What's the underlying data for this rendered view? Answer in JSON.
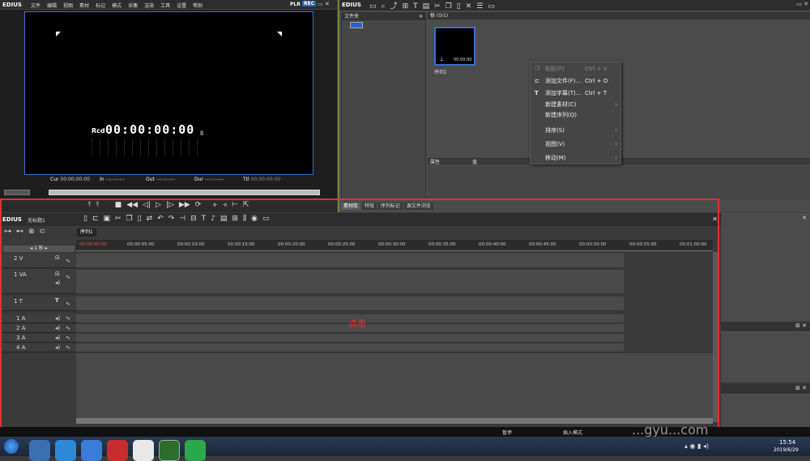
{
  "player": {
    "brand": "EDIUS",
    "menus": [
      "文件",
      "编辑",
      "视图",
      "素材",
      "标记",
      "模式",
      "采集",
      "渲染",
      "工具",
      "设置",
      "帮助"
    ],
    "plr": "PLR",
    "rec": "REC",
    "rcd": "Rcd",
    "timecode": "00:00:00:00",
    "cur_label": "Cur",
    "cur_val": "00:00:00:00",
    "in_label": "In",
    "in_val": "--:--:--:--",
    "out_label": "Out",
    "out_val": "--:--:--:--",
    "ttl_label": "Ttl",
    "ttl_val": "00:00:00:00"
  },
  "bin": {
    "brand": "EDIUS",
    "folder_header": "文件夹",
    "root_label": "根 (0/1)",
    "clip_label": "序列1",
    "clip_overlay": "00:00:00",
    "props_col1": "属性",
    "props_col2": "值",
    "tabs": [
      "素材库",
      "特效",
      "序列标记",
      "源文件浏览"
    ]
  },
  "context_menu": [
    {
      "label": "粘贴(P)",
      "key": "Ctrl + V",
      "disabled": true,
      "icon": "paste-icon"
    },
    {
      "label": "添加文件(F)...",
      "key": "Ctrl + O",
      "icon": "add-file-icon"
    },
    {
      "label": "添加字幕(T)...",
      "key": "Ctrl + T",
      "icon": "title-icon"
    },
    {
      "label": "新建素材(C)",
      "submenu": true
    },
    {
      "label": "新建序列(Q)"
    },
    {
      "label": "排序(S)",
      "submenu": true
    },
    {
      "label": "视图(V)",
      "submenu": true
    },
    {
      "label": "移动(M)",
      "submenu": true
    }
  ],
  "timeline": {
    "brand": "EDIUS",
    "project": "无标题1",
    "seq_tab": "序列1",
    "scale": "1 秒",
    "ruler": [
      "00:00:00:00",
      "00:00:05:00",
      "00:00:10:00",
      "00:00:15:00",
      "00:00:20:00",
      "00:00:25:00",
      "00:00:30:00",
      "00:00:35:00",
      "00:00:40:00",
      "00:00:45:00",
      "00:00:50:00",
      "00:00:55:00",
      "00:01:00:00"
    ],
    "tracks": [
      "2 V",
      "1 VA",
      "1 T",
      "1 A",
      "2 A",
      "3 A",
      "4 A"
    ],
    "annotation": "点击",
    "annotation_color": "#e53030"
  },
  "status": {
    "pause": "暂停",
    "mode": "插入模式"
  },
  "taskbar": {
    "time": "15:54",
    "date": "2019/6/29"
  },
  "watermark": "...gyu...com"
}
